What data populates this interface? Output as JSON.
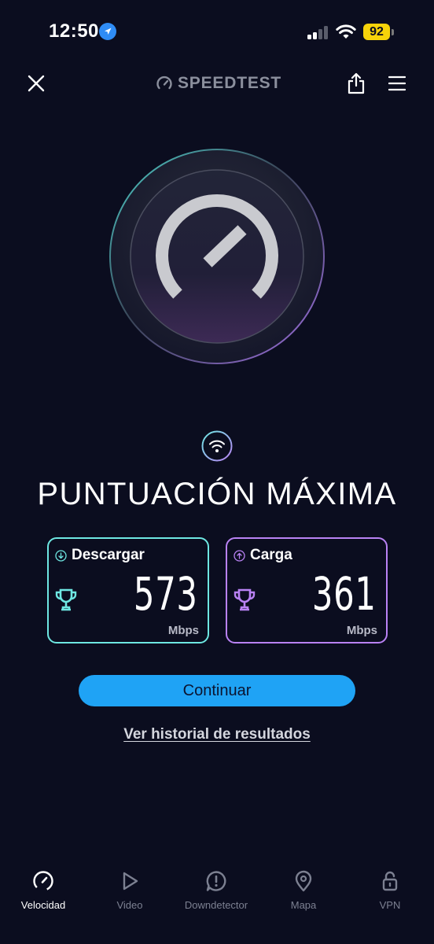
{
  "status_bar": {
    "time": "12:50",
    "battery": "92"
  },
  "header": {
    "brand": "SPEEDTEST"
  },
  "result": {
    "title": "PUNTUACIÓN MÁXIMA",
    "download": {
      "label": "Descargar",
      "value": "573",
      "unit": "Mbps"
    },
    "upload": {
      "label": "Carga",
      "value": "361",
      "unit": "Mbps"
    }
  },
  "actions": {
    "continue_label": "Continuar",
    "history_label": "Ver historial de resultados"
  },
  "nav": {
    "items": [
      {
        "label": "Velocidad",
        "icon": "gauge-icon",
        "active": true
      },
      {
        "label": "Video",
        "icon": "play-icon"
      },
      {
        "label": "Downdetector",
        "icon": "alert-icon"
      },
      {
        "label": "Mapa",
        "icon": "map-pin-icon"
      },
      {
        "label": "VPN",
        "icon": "lock-icon"
      }
    ]
  },
  "colors": {
    "background": "#0b0d1f",
    "download_accent": "#6ee7e2",
    "upload_accent": "#b982f4",
    "button": "#1fa3f5",
    "battery": "#f6d30a"
  }
}
